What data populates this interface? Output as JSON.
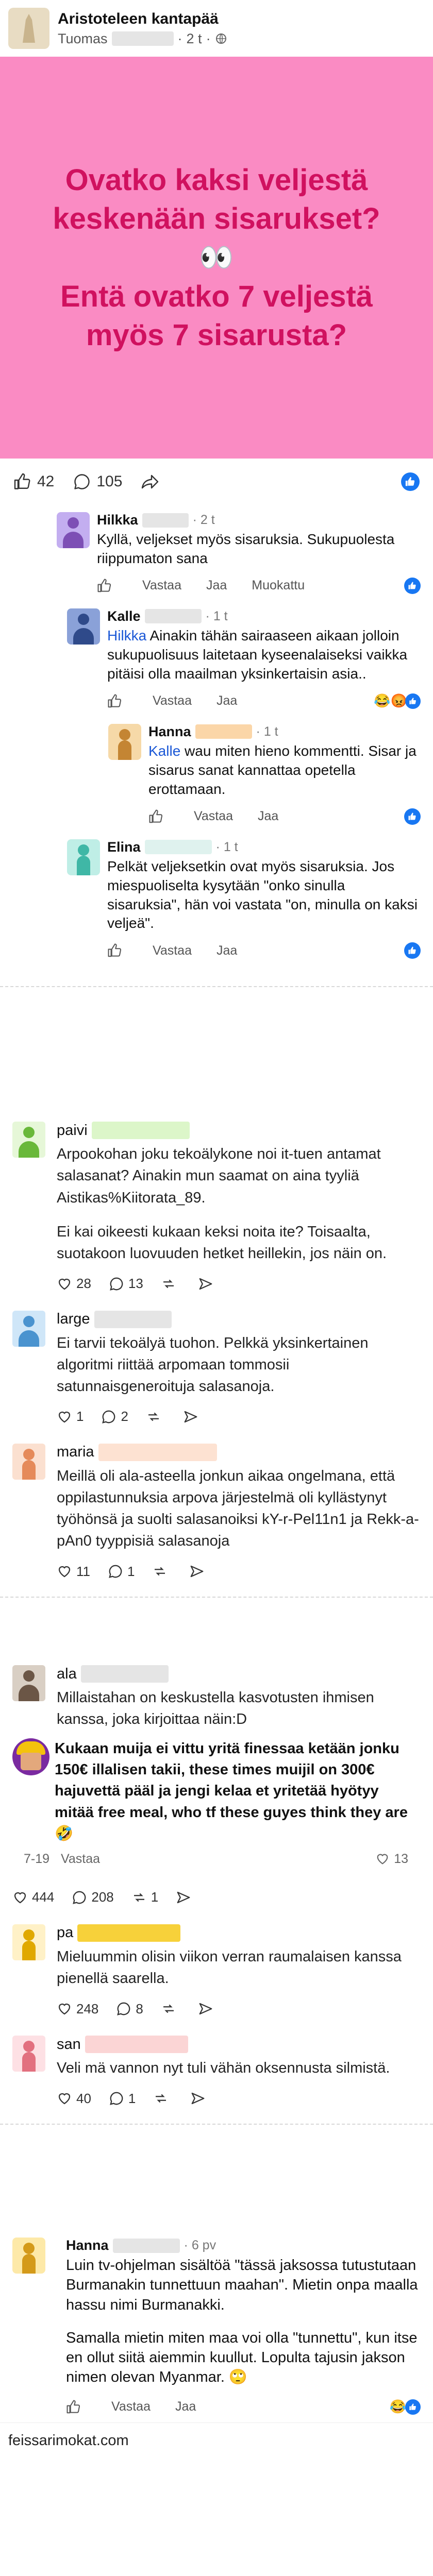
{
  "post": {
    "group_name": "Aristoteleen kantapää",
    "author": "Tuomas",
    "time": "2 t",
    "sep": "·",
    "question_line1": "Ovatko kaksi veljestä keskenään sisarukset?",
    "eyes": "👀",
    "question_line2": "Entä ovatko 7 veljestä myös 7 sisarusta?",
    "likes": "42",
    "comments": "105"
  },
  "fb_comments": [
    {
      "name": "Hilkka",
      "time": "2 t",
      "text": "Kyllä, veljekset myös sisaruksia. Sukupuolesta riippumaton sana",
      "reply": "Vastaa",
      "like": "Jaa",
      "extra": "Muokattu"
    },
    {
      "name": "Kalle",
      "time": "1 t",
      "mention": "Hilkka",
      "text": " Ainakin tähän sairaaseen aikaan jolloin sukupuolisuus laitetaan kyseenalaiseksi vaikka pitäisi olla maailman yksinkertaisin asia..",
      "reply": "Vastaa",
      "like": "Jaa",
      "emojis": "😂😡"
    },
    {
      "name": "Hanna",
      "time": "1 t",
      "mention": "Kalle",
      "text": " wau miten hieno kommentti. Sisar ja sisarus sanat kannattaa opetella erottamaan.",
      "reply": "Vastaa",
      "like": "Jaa"
    },
    {
      "name": "Elina",
      "time": "1 t",
      "text": "Pelkät veljeksetkin ovat myös sisaruksia. Jos miespuoliselta kysytään \"onko sinulla sisaruksia\", hän voi vastata \"on, minulla on kaksi veljeä\".",
      "reply": "Vastaa",
      "like": "Jaa"
    }
  ],
  "thread1": [
    {
      "name": "paivi",
      "paras": [
        "Arpookohan joku tekoälykone noi it-tuen antamat salasanat? Ainakin mun saamat on aina tyyliä Aistikas%Kiitorata_89.",
        "Ei kai oikeesti kukaan keksi noita ite? Toisaalta, suotakoon luovuuden hetket heillekin, jos näin on."
      ],
      "likes": "28",
      "comments": "13"
    },
    {
      "name": "large",
      "paras": [
        "Ei tarvii tekoälyä tuohon. Pelkkä yksinkertainen algoritmi riittää arpomaan tommosii satunnaisgeneroituja salasanoja."
      ],
      "likes": "1",
      "comments": "2"
    },
    {
      "name": "maria",
      "paras": [
        "Meillä oli ala-asteella jonkun aikaa ongelmana, että oppilastunnuksia arpova järjestelmä oli kyllästynyt työhönsä ja suolti salasanoiksi kY-r-Pel11n1 ja Rekk-a-pAn0 tyyppisiä salasanoja"
      ],
      "likes": "11",
      "comments": "1"
    }
  ],
  "thread2": {
    "op": {
      "name": "ala",
      "text": "Millaistahan on keskustella kasvotusten ihmisen kanssa, joka kirjoittaa näin:D"
    },
    "quote": {
      "text": "Kukaan muija ei vittu yritä finessaa ketään jonku 150€ illalisen takii, these times muijil on 300€ hajuvettä pääl ja jengi kelaa et yritetää hyötyy mitää free meal, who tf these guyes think they are 🤣",
      "date": "7-19",
      "reply": "Vastaa",
      "likes": "13"
    },
    "stats": {
      "likes": "444",
      "comments": "208",
      "reposts": "1"
    },
    "replies": [
      {
        "name": "pa",
        "text": "Mieluummin olisin viikon verran raumalaisen kanssa pienellä saarella.",
        "likes": "248",
        "comments": "8"
      },
      {
        "name": "san",
        "text": "Veli mä vannon nyt tuli vähän oksennusta silmistä.",
        "likes": "40",
        "comments": "1"
      }
    ]
  },
  "last": {
    "name": "Hanna",
    "time": "6 pv",
    "paras": [
      "Luin tv-ohjelman sisältöä \"tässä jaksossa tutustutaan Burmanakin tunnettuun maahan\". Mietin onpa maalla hassu nimi Burmanakki.",
      "Samalla mietin miten maa voi olla \"tunnettu\", kun itse en ollut siitä aiemmin kuullut. Lopulta tajusin jakson nimen olevan Myanmar. 🙄"
    ],
    "reply": "Vastaa",
    "like": "Jaa",
    "emojis": "😂"
  },
  "watermark": "feissarimokat.com",
  "colors": {
    "accent": "#1877f2",
    "pink_bg": "#fa8bc3",
    "question": "#d0115f"
  }
}
